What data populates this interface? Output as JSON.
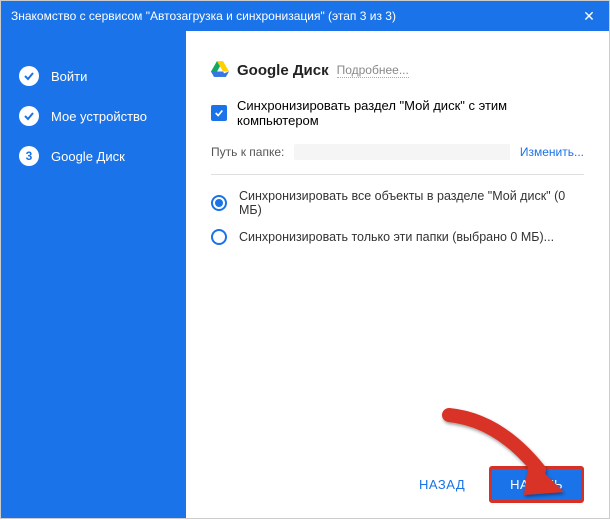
{
  "titlebar": {
    "title": "Знакомство с сервисом \"Автозагрузка и синхронизация\" (этап 3 из 3)"
  },
  "sidebar": {
    "steps": [
      {
        "label": "Войти",
        "state": "done"
      },
      {
        "label": "Мое устройство",
        "state": "done"
      },
      {
        "label": "Google Диск",
        "state": "current",
        "number": "3"
      }
    ]
  },
  "main": {
    "heading": "Google Диск",
    "more": "Подробнее...",
    "sync_checkbox_label": "Синхронизировать раздел \"Мой диск\" с этим компьютером",
    "path_label": "Путь к папке:",
    "change_link": "Изменить...",
    "radio_all": "Синхронизировать все объекты в разделе \"Мой диск\" (0 МБ)",
    "radio_some": "Синхронизировать только эти папки (выбрано 0 МБ)..."
  },
  "footer": {
    "back": "НАЗАД",
    "start": "НАЧАТЬ"
  },
  "colors": {
    "accent": "#1a73e8",
    "arrow": "#d93025"
  }
}
